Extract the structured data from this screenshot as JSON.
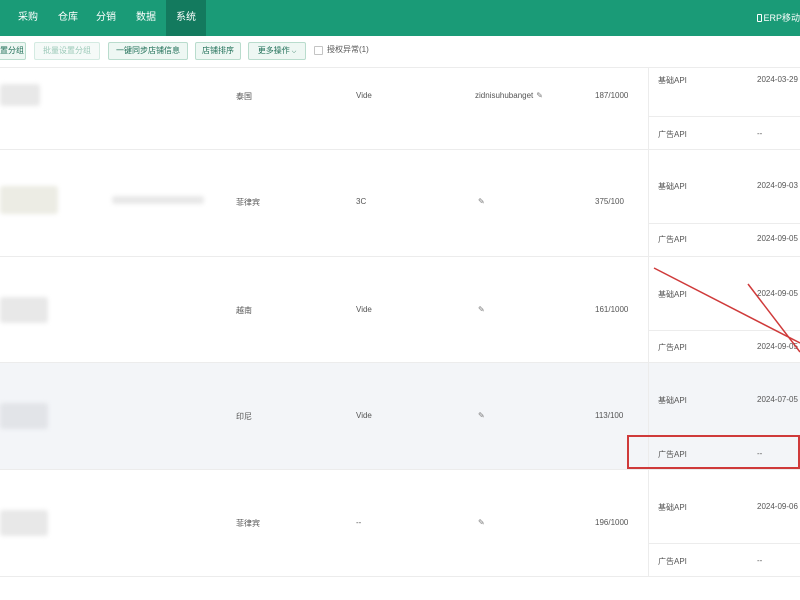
{
  "nav": {
    "items": [
      {
        "label": "采购",
        "id": "purchase"
      },
      {
        "label": "仓库",
        "id": "warehouse"
      },
      {
        "label": "分销",
        "id": "distribution"
      },
      {
        "label": "数据",
        "id": "data"
      },
      {
        "label": "系统",
        "id": "system",
        "active": true
      }
    ],
    "erp_mobile": "ERP移动"
  },
  "toolbar": {
    "set_group": "置分组",
    "batch_set_group": "批量设置分组",
    "sync_shop_info": "一键同步店铺信息",
    "shop_sort": "店铺排序",
    "more_actions": "更多操作",
    "auth_error": "授权异常(1)"
  },
  "rows": [
    {
      "country": "泰国",
      "category": "Vide",
      "account": "zidnisuhubanget",
      "quota": "187/1000",
      "api1": "基础API",
      "date1": "2024-03-29",
      "api2": "广告API",
      "date2": "--"
    },
    {
      "country": "菲律宾",
      "category": "3C",
      "account": "",
      "quota": "375/100",
      "api1": "基础API",
      "date1": "2024-09-03",
      "api2": "广告API",
      "date2": "2024-09-05"
    },
    {
      "country": "越南",
      "category": "Vide",
      "account": "",
      "quota": "161/1000",
      "api1": "基础API",
      "date1": "2024-09-05",
      "api2": "广告API",
      "date2": "2024-09-05"
    },
    {
      "country": "印尼",
      "category": "Vide",
      "account": "",
      "quota": "113/100",
      "api1": "基础API",
      "date1": "2024-07-05",
      "api2": "广告API",
      "date2": "--"
    },
    {
      "country": "菲律宾",
      "category": "--",
      "account": "",
      "quota": "196/1000",
      "api1": "基础API",
      "date1": "2024-09-06",
      "api2": "广告API",
      "date2": "--"
    }
  ],
  "colors": {
    "brand": "#1a9b77",
    "nav_active": "#137a5e",
    "annotation": "#cf3a3a",
    "row_highlight": "#f3f5f8"
  }
}
